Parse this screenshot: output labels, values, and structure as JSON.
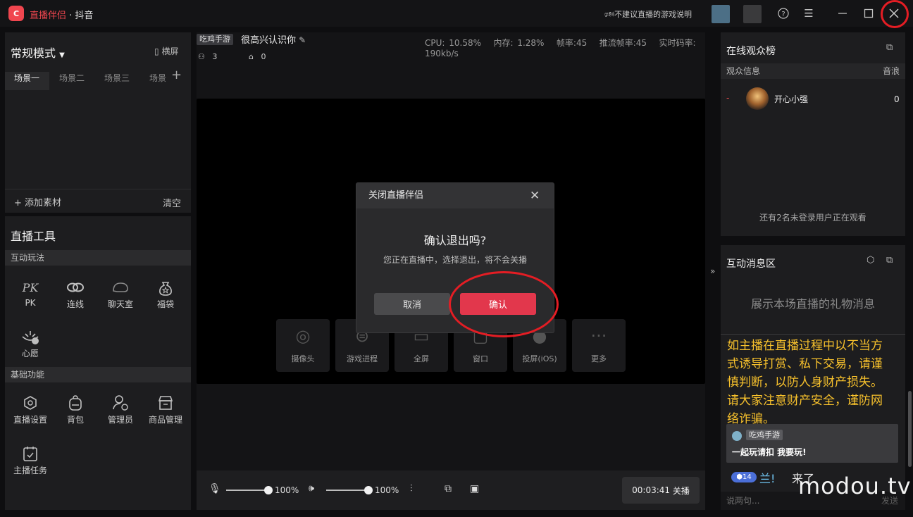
{
  "titlebar": {
    "app_name": "直播伴侣",
    "separator": " · ",
    "platform": "抖音",
    "logo_text": "C",
    "notice": "不建议直播的游戏说明"
  },
  "left": {
    "mode": "常规模式",
    "landscape": "横屏",
    "scenes": [
      "场景一",
      "场景二",
      "场景三",
      "场景"
    ],
    "add_material": "添加素材",
    "clear": "清空",
    "tools_title": "直播工具",
    "interactive_title": "互动玩法",
    "interactive_tools": [
      {
        "label": "PK",
        "icon": "pk-icon"
      },
      {
        "label": "连线",
        "icon": "link-icon"
      },
      {
        "label": "聊天室",
        "icon": "chatroom-icon"
      },
      {
        "label": "福袋",
        "icon": "lucky-bag-icon"
      },
      {
        "label": "心愿",
        "icon": "wish-icon"
      }
    ],
    "basic_title": "基础功能",
    "basic_tools": [
      {
        "label": "直播设置",
        "icon": "live-settings-icon"
      },
      {
        "label": "背包",
        "icon": "backpack-icon"
      },
      {
        "label": "管理员",
        "icon": "admin-icon"
      },
      {
        "label": "商品管理",
        "icon": "store-icon"
      },
      {
        "label": "主播任务",
        "icon": "tasks-icon"
      }
    ]
  },
  "center": {
    "category": "吃鸡手游",
    "stream_title": "很高兴认识你",
    "viewers": "3",
    "gifts": "0",
    "stats": {
      "cpu": "CPU: 10.58%",
      "memory": "内存: 1.28%",
      "fps": "帧率:45",
      "push_fps": "推流帧率:45",
      "bitrate": "实时码率: 190kb/s"
    },
    "sources": [
      "摄像头",
      "游戏进程",
      "全屏",
      "窗口",
      "投屏(iOS)",
      "更多"
    ],
    "mic_volume": "100%",
    "speaker_volume": "100%",
    "mic_level": 1.0,
    "speaker_level": 1.0,
    "timer": "00:03:41",
    "end_live": "关播"
  },
  "dialog": {
    "title": "关闭直播伴侣",
    "question": "确认退出吗?",
    "description": "您正在直播中，选择退出，将不会关播",
    "cancel": "取消",
    "confirm": "确认"
  },
  "audience": {
    "title": "在线观众榜",
    "col_info": "观众信息",
    "col_score": "音浪",
    "viewer_rank": "-",
    "viewer_name": "开心小强",
    "viewer_score": "0",
    "unlogged_note": "还有2名未登录用户正在观看"
  },
  "chat": {
    "title": "互动消息区",
    "gift_placeholder": "展示本场直播的礼物消息",
    "warning": "如主播在直播过程中以不当方式诱导打赏、私下交易，请谨慎判断，以防人身财产损失。请大家注意财产安全，谨防网络诈骗。",
    "msg_badge": "吃鸡手游",
    "msg_text": "一起玩请扣 我要玩!",
    "fan_level": "14",
    "fan_name": "兰!",
    "fan_msg": "来了",
    "input_placeholder": "说两句...",
    "send": "发送"
  },
  "watermark": "modou.tv",
  "colors": {
    "accent": "#f0464f",
    "confirm": "#e2374c",
    "highlight_ring": "#e41d24",
    "warning_text": "#f7c12c"
  }
}
